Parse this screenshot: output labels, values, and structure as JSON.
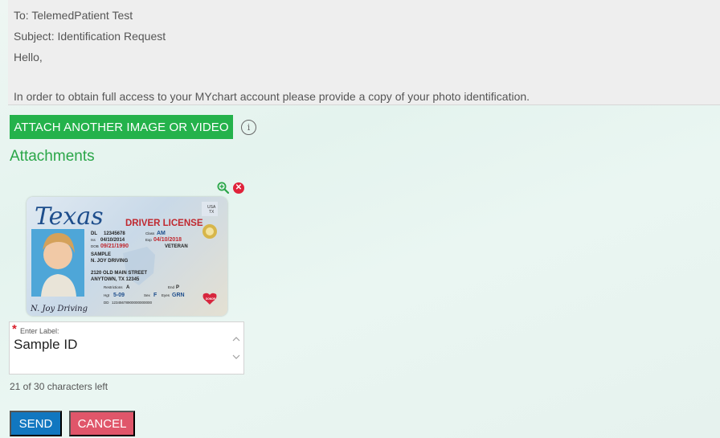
{
  "message": {
    "to": "To: TelemedPatient Test",
    "subject": "Subject: Identification Request",
    "greeting": "Hello,",
    "body": "In order to obtain full access to your MYchart account please provide a copy of your photo identification."
  },
  "attach_button_label": "ATTACH ANOTHER IMAGE OR VIDEO",
  "attachments_heading": "Attachments",
  "id_card": {
    "state": "Texas",
    "type": "DRIVER LICENSE",
    "usa": "USA",
    "tx": "TX",
    "dl_label": "DL",
    "dl": "12345678",
    "class_label": "Class",
    "class": "AM",
    "iss_label": "Iss",
    "iss": "04/10/2014",
    "exp_label": "Exp",
    "exp": "04/10/2018",
    "dob_label": "DOB",
    "dob": "09/21/1990",
    "veteran": "VETERAN",
    "last_name": "SAMPLE",
    "first_name": "N. JOY DRIVING",
    "address1": "2120 OLD MAIN STREET",
    "address2": "ANYTOWN, TX 12345",
    "restrictions_label": "Restrictions",
    "restrictions": "A",
    "end_label": "End",
    "end": "P",
    "hgt_label": "Hgt",
    "hgt": "5-09",
    "sex_label": "Sex",
    "sex": "F",
    "eyes_label": "Eyes",
    "eyes": "GRN",
    "dd_label": "DD",
    "dd": "12345678900000000000",
    "donor": "DONOR",
    "signature": "N. Joy Driving"
  },
  "label_field": {
    "prompt": "Enter Label:",
    "value": "Sample ID"
  },
  "char_counter": "21 of 30 characters left",
  "send_label": "SEND",
  "cancel_label": "CANCEL",
  "colors": {
    "green_button": "#24b24b",
    "heading_green": "#2aa648",
    "send_blue": "#1177c0",
    "cancel_red": "#e0566a",
    "remove_red": "#e0223a"
  },
  "icons": {
    "info": "info-icon",
    "zoom": "zoom-in-icon",
    "remove": "remove-icon"
  }
}
